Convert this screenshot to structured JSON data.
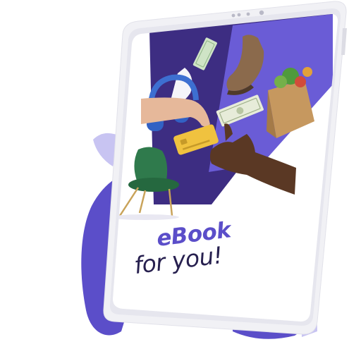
{
  "ebook": {
    "title_line1": "eBook",
    "title_line2": "for you!"
  },
  "colors": {
    "accent": "#5b4ec9",
    "accent_dark": "#3d2d82",
    "accent_light": "#c8c4f2",
    "text_dark": "#27204f",
    "device_frame": "#f1f1f5"
  },
  "icons": [
    "headphones-icon",
    "shoe-icon",
    "money-icon",
    "grocery-bag-icon",
    "credit-card-icon",
    "chair-icon",
    "hand-icon"
  ]
}
